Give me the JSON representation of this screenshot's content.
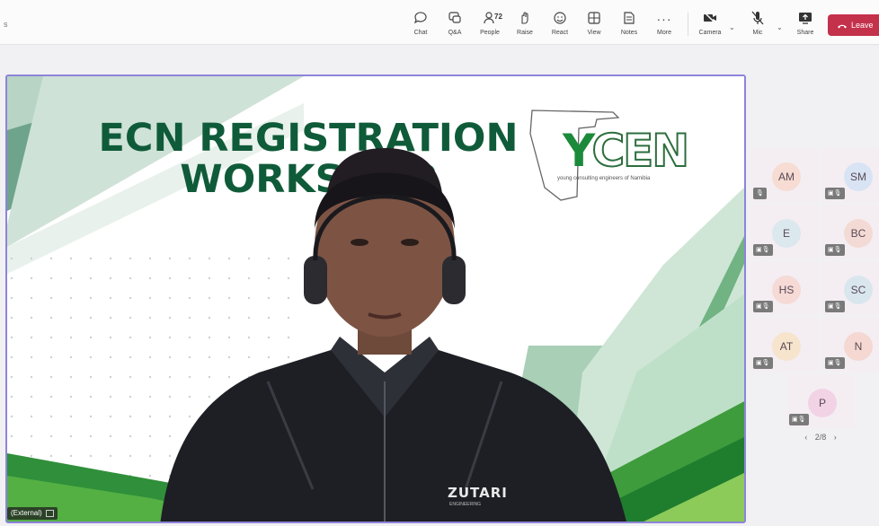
{
  "toolbar": {
    "left_text": "s",
    "buttons": [
      {
        "label": "Chat",
        "icon": "chat-icon"
      },
      {
        "label": "Q&A",
        "icon": "qa-icon"
      },
      {
        "label": "People",
        "icon": "people-icon",
        "count": "72"
      },
      {
        "label": "Raise",
        "icon": "raise-hand-icon"
      },
      {
        "label": "React",
        "icon": "react-icon"
      },
      {
        "label": "View",
        "icon": "view-icon"
      },
      {
        "label": "Notes",
        "icon": "notes-icon"
      },
      {
        "label": "More",
        "icon": "more-icon"
      },
      {
        "label": "Camera",
        "icon": "camera-icon"
      },
      {
        "label": "Mic",
        "icon": "mic-icon"
      },
      {
        "label": "Share",
        "icon": "share-icon"
      }
    ],
    "leave_label": "Leave",
    "leave_color": "#c4314b"
  },
  "stage": {
    "slide_title_line1": "ECN REGISTRATION",
    "slide_title_line2": "WORKSHOP",
    "logo_first_letter": "Y",
    "logo_rest": "CEN",
    "logo_tagline": "young consulting engineers of Namibia",
    "jacket_brand": "ZUTARI",
    "jacket_sub": "ENGINEERING",
    "speaker_name_tag": "(External)",
    "accent_color": "#8d84d9",
    "slide_green": "#0f5b39"
  },
  "participants": [
    {
      "initials": "AM",
      "color": "#f6dcd2"
    },
    {
      "initials": "SM",
      "color": "#d8e3f4"
    },
    {
      "initials": "E",
      "color": "#dbe8ee"
    },
    {
      "initials": "BC",
      "color": "#f3dad4"
    },
    {
      "initials": "HS",
      "color": "#f5dad6"
    },
    {
      "initials": "SC",
      "color": "#d9e6ee"
    },
    {
      "initials": "AT",
      "color": "#f6e4cc"
    },
    {
      "initials": "N",
      "color": "#f5d8d2"
    },
    {
      "initials": "P",
      "color": "#f2d3e6"
    }
  ],
  "pager": {
    "text": "2/8",
    "prev": "‹",
    "next": "›"
  }
}
